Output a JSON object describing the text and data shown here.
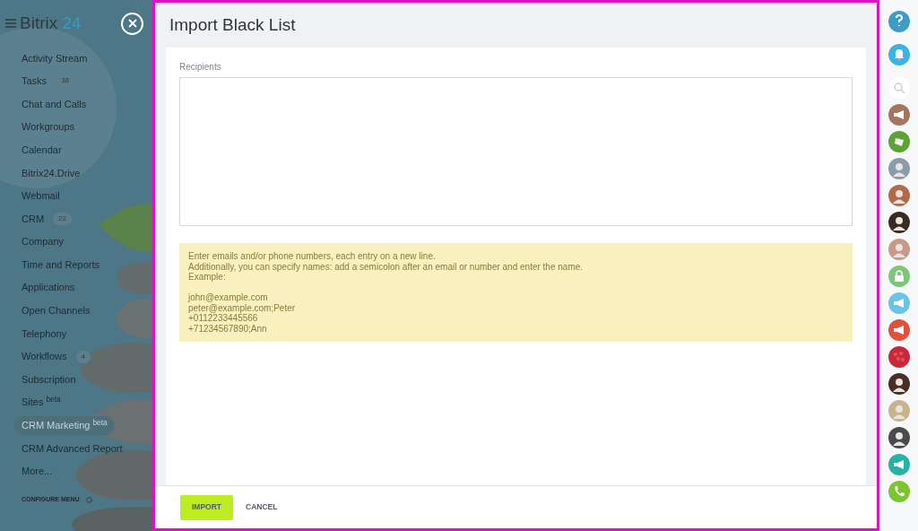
{
  "logo": {
    "brand": "Bitrix",
    "number": "24"
  },
  "menu": [
    {
      "label": "Activity Stream",
      "selected": false
    },
    {
      "label": "Tasks",
      "badge": "38",
      "selected": false
    },
    {
      "label": "Chat and Calls",
      "selected": false
    },
    {
      "label": "Workgroups",
      "selected": false
    },
    {
      "label": "Calendar",
      "selected": false
    },
    {
      "label": "Bitrix24.Drive",
      "selected": false
    },
    {
      "label": "Webmail",
      "selected": false
    },
    {
      "label": "CRM",
      "badge": "22",
      "selected": false
    },
    {
      "label": "Company",
      "selected": false
    },
    {
      "label": "Time and Reports",
      "selected": false
    },
    {
      "label": "Applications",
      "selected": false
    },
    {
      "label": "Open Channels",
      "selected": false
    },
    {
      "label": "Telephony",
      "selected": false
    },
    {
      "label": "Workflows",
      "badge": "4",
      "selected": false
    },
    {
      "label": "Subscription",
      "selected": false
    },
    {
      "label": "Sites $^{beta}$",
      "selected": false
    },
    {
      "label": "CRM Marketing $^{beta}$",
      "selected": true
    },
    {
      "label": "CRM Advanced Report",
      "selected": false
    },
    {
      "label": "More...",
      "selected": false
    }
  ],
  "configure_menu": "CONFIGURE MENU",
  "slider": {
    "title": "Import Black List",
    "recipients": {
      "label": "Recipients"
    },
    "hint": {
      "intro": [
        "Enter emails and/or phone numbers, each entry on a new line.",
        "Additionally, you can specify names: add a semicolon after an email or number and enter the name.",
        "Example:"
      ],
      "examples": [
        "john@example.com",
        "peter@example.com;Peter",
        "+0112233445566",
        "+71234567890;Ann"
      ]
    },
    "buttons": [
      "IMPORT",
      "CANCEL"
    ]
  },
  "right_bar": [
    {
      "kind": "help",
      "color": "#3c9ec4"
    },
    {
      "kind": "bell",
      "color": "#3bb3e4"
    },
    {
      "kind": "search",
      "color": "#ffffff"
    },
    {
      "kind": "megaphone",
      "color": "#a5765e"
    },
    {
      "kind": "note",
      "color": "#5da234"
    },
    {
      "kind": "avatar",
      "color": "#8a9bab"
    },
    {
      "kind": "avatar",
      "color": "#b56a47"
    },
    {
      "kind": "avatar",
      "color": "#3a2a24"
    },
    {
      "kind": "avatar",
      "color": "#c79a88"
    },
    {
      "kind": "lock",
      "color": "#7ec77a"
    },
    {
      "kind": "megaphone",
      "color": "#6bc3e6"
    },
    {
      "kind": "megaphone",
      "color": "#e0533a"
    },
    {
      "kind": "picture",
      "color": "#c8283a"
    },
    {
      "kind": "avatar",
      "color": "#4a2e26"
    },
    {
      "kind": "avatar",
      "color": "#c8b48a"
    },
    {
      "kind": "avatar",
      "color": "#4a4a4a"
    },
    {
      "kind": "megaphone",
      "color": "#27b2a6"
    },
    {
      "kind": "phone",
      "color": "#7cc62d"
    }
  ]
}
